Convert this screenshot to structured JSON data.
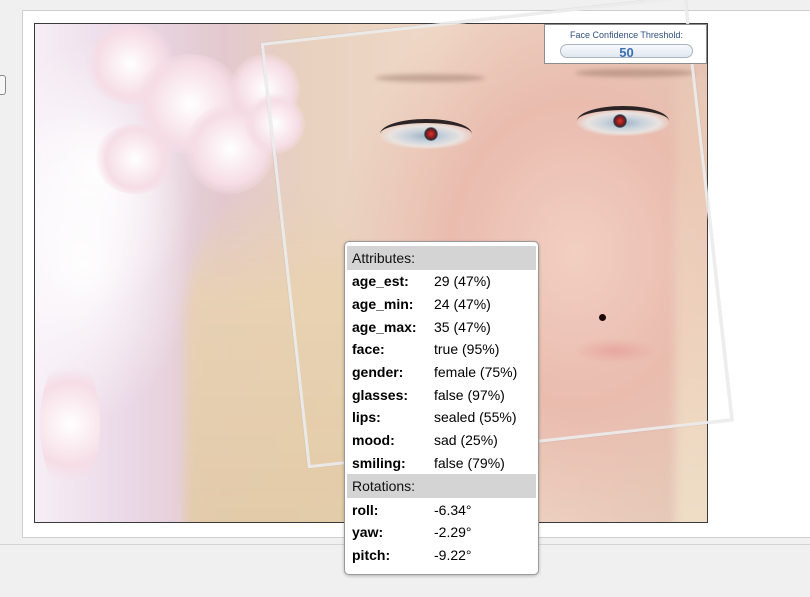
{
  "threshold": {
    "label": "Face Confidence Threshold:",
    "value": "50"
  },
  "attributes": {
    "header": "Attributes:",
    "rows": [
      {
        "key": "age_est:",
        "value": "29 (47%)"
      },
      {
        "key": "age_min:",
        "value": "24 (47%)"
      },
      {
        "key": "age_max:",
        "value": "35 (47%)"
      },
      {
        "key": "face:",
        "value": "true (95%)"
      },
      {
        "key": "gender:",
        "value": "female (75%)"
      },
      {
        "key": "glasses:",
        "value": "false (97%)"
      },
      {
        "key": "lips:",
        "value": "sealed (55%)"
      },
      {
        "key": "mood:",
        "value": "sad (25%)"
      },
      {
        "key": "smiling:",
        "value": "false (79%)"
      }
    ]
  },
  "rotations": {
    "header": "Rotations:",
    "rows": [
      {
        "key": "roll:",
        "value": "-6.34°"
      },
      {
        "key": "yaw:",
        "value": "-2.29°"
      },
      {
        "key": "pitch:",
        "value": "-9.22°"
      }
    ]
  },
  "colors": {
    "section_header_bg": "#d4d4d4",
    "threshold_text": "#2f4f7f",
    "threshold_value": "#3a6fb5",
    "face_box": "#ebebeb"
  }
}
